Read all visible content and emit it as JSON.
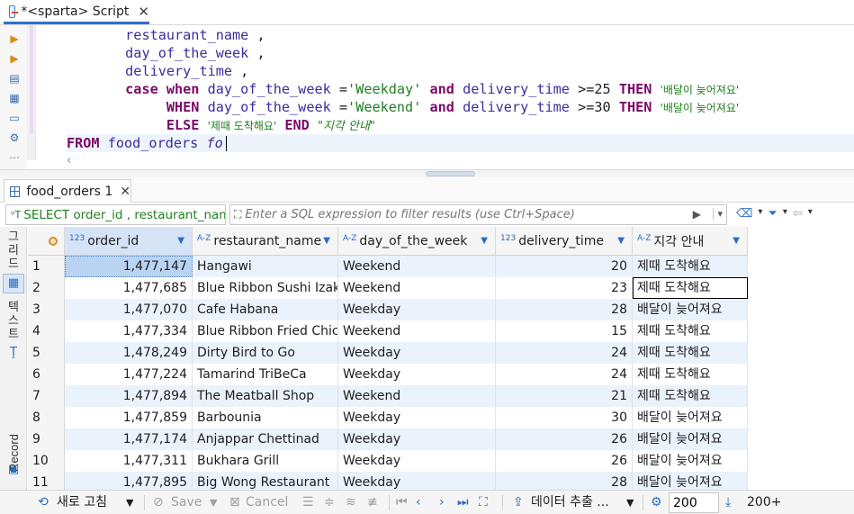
{
  "editor_tab": {
    "title": "*<sparta> Script",
    "close": "✕"
  },
  "code_lines": [
    [
      {
        "t": "        "
      },
      {
        "t": "restaurant_name",
        "c": "id"
      },
      {
        "t": " ,",
        "c": "pl"
      }
    ],
    [
      {
        "t": "        "
      },
      {
        "t": "day_of_the_week",
        "c": "id"
      },
      {
        "t": " ,",
        "c": "pl"
      }
    ],
    [
      {
        "t": "        "
      },
      {
        "t": "delivery_time",
        "c": "id"
      },
      {
        "t": " ,",
        "c": "pl"
      }
    ],
    [
      {
        "t": "        "
      },
      {
        "t": "case when ",
        "c": "kw"
      },
      {
        "t": "day_of_the_week",
        "c": "id"
      },
      {
        "t": " =",
        "c": "pl"
      },
      {
        "t": "'Weekday'",
        "c": "str"
      },
      {
        "t": " and ",
        "c": "kw"
      },
      {
        "t": "delivery_time",
        "c": "id"
      },
      {
        "t": " >=25 ",
        "c": "pl"
      },
      {
        "t": "THEN ",
        "c": "kw"
      },
      {
        "t": "'배달이 늦어져요'",
        "c": "kstr"
      }
    ],
    [
      {
        "t": "             "
      },
      {
        "t": "WHEN ",
        "c": "kw"
      },
      {
        "t": "day_of_the_week",
        "c": "id"
      },
      {
        "t": " =",
        "c": "pl"
      },
      {
        "t": "'Weekend'",
        "c": "str"
      },
      {
        "t": " and ",
        "c": "kw"
      },
      {
        "t": "delivery_time",
        "c": "id"
      },
      {
        "t": " >=30 ",
        "c": "pl"
      },
      {
        "t": "THEN ",
        "c": "kw"
      },
      {
        "t": "'배달이 늦어져요'",
        "c": "kstr"
      }
    ],
    [
      {
        "t": "             "
      },
      {
        "t": "ELSE ",
        "c": "kw"
      },
      {
        "t": "'제때 도착해요'",
        "c": "kstr"
      },
      {
        "t": " END ",
        "c": "kw"
      },
      {
        "t": "\"지각 안내\"",
        "c": "al"
      }
    ],
    [
      {
        "t": "FROM ",
        "c": "kw"
      },
      {
        "t": "food_orders",
        "c": "id"
      },
      {
        "t": " fo",
        "c": "ital"
      }
    ]
  ],
  "results_tab": {
    "title": "food_orders 1",
    "close": "✕"
  },
  "filter": {
    "sql_preview": "SELECT order_id , restaurant_nam",
    "placeholder": "Enter a SQL expression to filter results (use Ctrl+Space)"
  },
  "side_tabs": {
    "grid": "그리드",
    "text": "텍스트",
    "record": "Record"
  },
  "columns": [
    {
      "name": "order_id",
      "type": "123"
    },
    {
      "name": "restaurant_name",
      "type": "A-Z"
    },
    {
      "name": "day_of_the_week",
      "type": "A-Z"
    },
    {
      "name": "delivery_time",
      "type": "123"
    },
    {
      "name": "지각 안내",
      "type": "A-Z"
    }
  ],
  "rows": [
    {
      "n": "1",
      "order_id": "1,477,147",
      "restaurant_name": "Hangawi",
      "day_of_the_week": "Weekend",
      "delivery_time": "20",
      "note": "제때 도착해요"
    },
    {
      "n": "2",
      "order_id": "1,477,685",
      "restaurant_name": "Blue Ribbon Sushi Izakaya",
      "day_of_the_week": "Weekend",
      "delivery_time": "23",
      "note": "제때 도착해요"
    },
    {
      "n": "3",
      "order_id": "1,477,070",
      "restaurant_name": "Cafe Habana",
      "day_of_the_week": "Weekday",
      "delivery_time": "28",
      "note": "배달이 늦어져요"
    },
    {
      "n": "4",
      "order_id": "1,477,334",
      "restaurant_name": "Blue Ribbon Fried Chicken",
      "day_of_the_week": "Weekend",
      "delivery_time": "15",
      "note": "제때 도착해요"
    },
    {
      "n": "5",
      "order_id": "1,478,249",
      "restaurant_name": "Dirty Bird to Go",
      "day_of_the_week": "Weekday",
      "delivery_time": "24",
      "note": "제때 도착해요"
    },
    {
      "n": "6",
      "order_id": "1,477,224",
      "restaurant_name": "Tamarind TriBeCa",
      "day_of_the_week": "Weekday",
      "delivery_time": "24",
      "note": "제때 도착해요"
    },
    {
      "n": "7",
      "order_id": "1,477,894",
      "restaurant_name": "The Meatball Shop",
      "day_of_the_week": "Weekend",
      "delivery_time": "21",
      "note": "제때 도착해요"
    },
    {
      "n": "8",
      "order_id": "1,477,859",
      "restaurant_name": "Barbounia",
      "day_of_the_week": "Weekday",
      "delivery_time": "30",
      "note": "배달이 늦어져요"
    },
    {
      "n": "9",
      "order_id": "1,477,174",
      "restaurant_name": "Anjappar Chettinad",
      "day_of_the_week": "Weekday",
      "delivery_time": "26",
      "note": "배달이 늦어져요"
    },
    {
      "n": "10",
      "order_id": "1,477,311",
      "restaurant_name": "Bukhara Grill",
      "day_of_the_week": "Weekday",
      "delivery_time": "26",
      "note": "배달이 늦어져요"
    },
    {
      "n": "11",
      "order_id": "1,477,895",
      "restaurant_name": "Big Wong Restaurant",
      "day_of_the_week": "Weekday",
      "delivery_time": "28",
      "note": "배달이 늦어져요"
    }
  ],
  "status": {
    "refresh": "새로 고침",
    "save": "Save",
    "cancel": "Cancel",
    "export": "데이터 추출 ...",
    "fetch_size": "200",
    "row_count": "200+"
  },
  "colors": {
    "accent": "#2a6cc4",
    "keyword": "#7a0a68",
    "identifier": "#3d2c9c",
    "string": "#1f7f1f",
    "alt_row": "#eaf2fc"
  }
}
